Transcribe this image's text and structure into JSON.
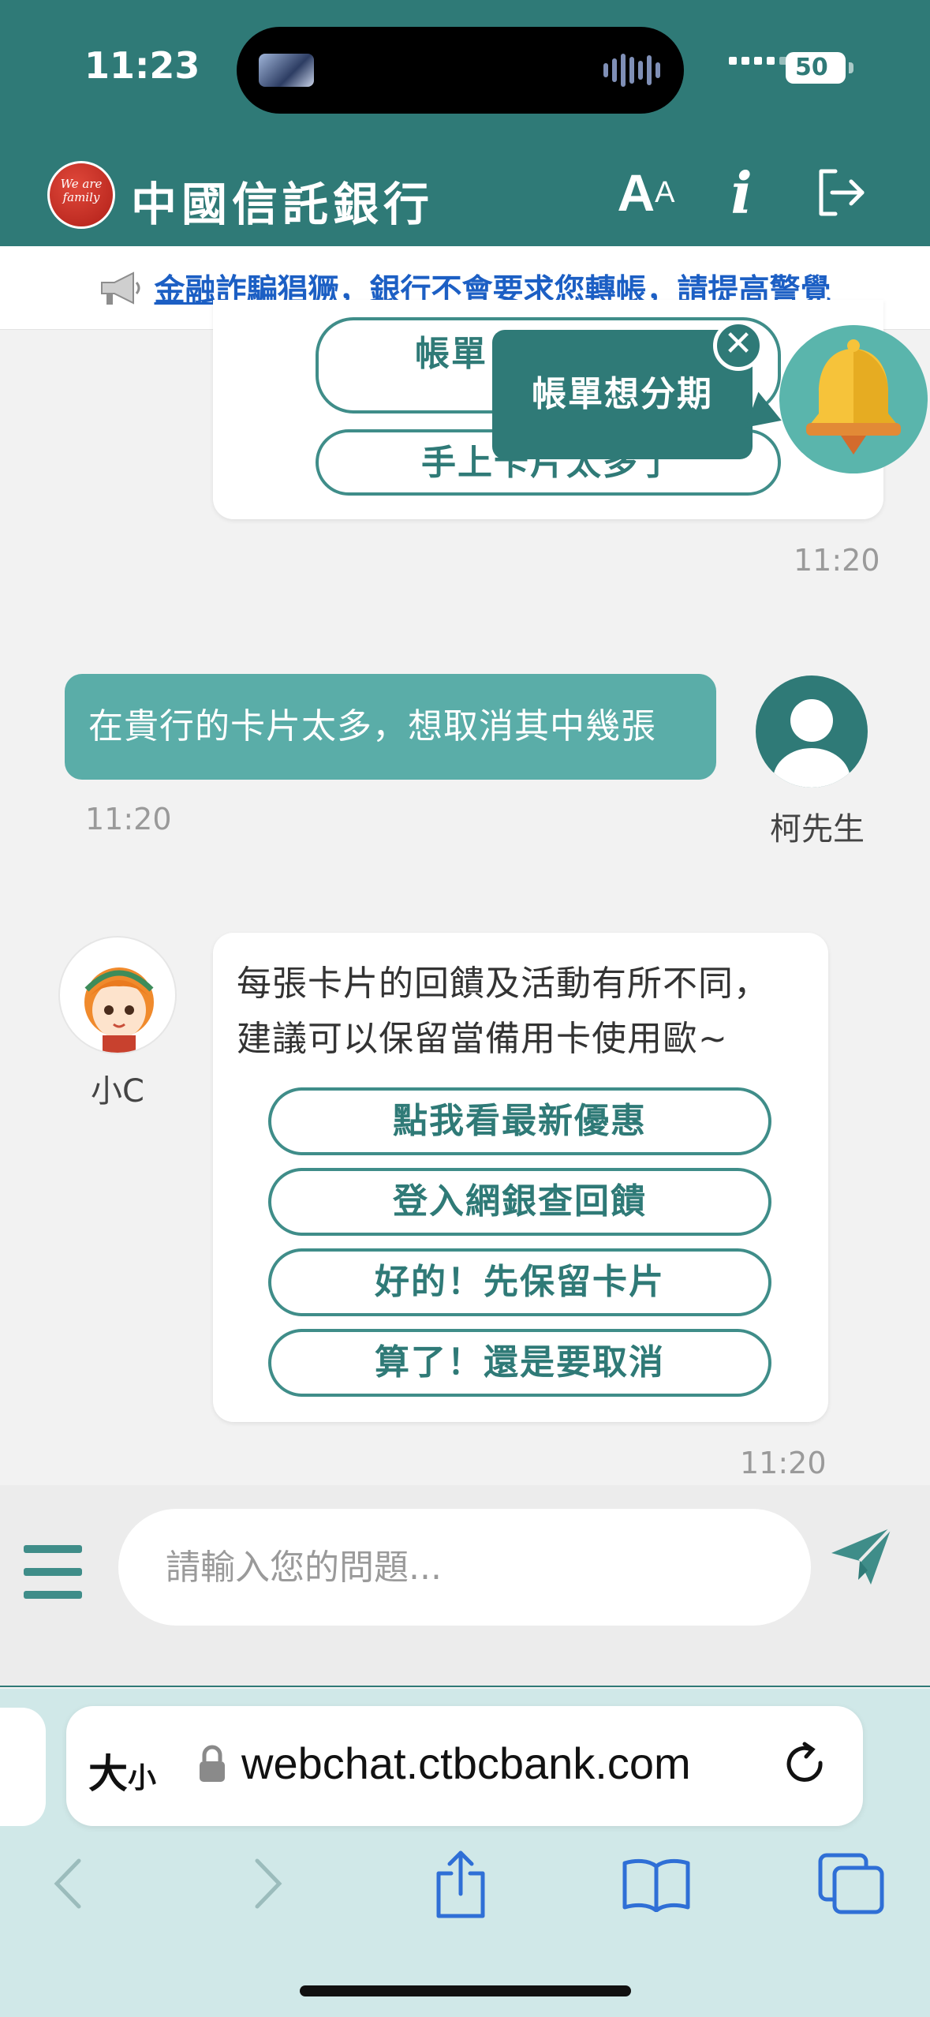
{
  "status_bar": {
    "time": "11:23",
    "battery": "50"
  },
  "header": {
    "logo_text": "We are family",
    "bank_name": "中國信託銀行",
    "font_size_glyph": "A",
    "font_size_glyph_small": "A",
    "info_glyph": "i"
  },
  "notice": {
    "text": "金融詐騙猖獗，銀行不會要求您轉帳，請提高警覺"
  },
  "popover": {
    "text": "帳單想分期",
    "close_glyph": "✕"
  },
  "chat": {
    "prev_options": [
      "帳單",
      "手上卡片太多了"
    ],
    "prev_time": "11:20",
    "user_message": "在貴行的卡片太多，想取消其中幾張",
    "user_time": "11:20",
    "user_name": "柯先生",
    "bot_name": "小C",
    "bot_message_line1": "每張卡片的回饋及活動有所不同，",
    "bot_message_line2": "建議可以保留當備用卡使用歐~",
    "bot_options": [
      "點我看最新優惠",
      "登入網銀查回饋",
      "好的！先保留卡片",
      "算了！還是要取消"
    ],
    "bot_time": "11:20"
  },
  "input": {
    "placeholder": "請輸入您的問題..."
  },
  "browser": {
    "size_label": "大",
    "size_label_small": "小",
    "url": "webchat.ctbcbank.com"
  },
  "icons": {
    "logout": "logout-icon",
    "bell": "bell-icon",
    "menu": "hamburger-menu-icon",
    "send": "send-icon",
    "megaphone": "megaphone-icon"
  },
  "colors": {
    "primary": "#2f7a77",
    "user_bubble": "#5aada8",
    "link": "#1c5fc4",
    "browser_bar": "#d0e8e8"
  }
}
